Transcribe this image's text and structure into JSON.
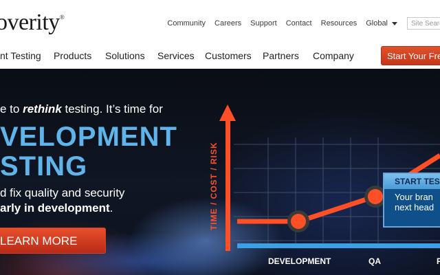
{
  "header": {
    "logo_text": "overity",
    "logo_mark": "®",
    "utility_links": [
      "Community",
      "Careers",
      "Support",
      "Contact",
      "Resources"
    ],
    "global_label": "Global",
    "search_placeholder": "Site Search"
  },
  "nav": {
    "items": [
      "nt Testing",
      "Products",
      "Solutions",
      "Services",
      "Customers",
      "Partners",
      "Company"
    ],
    "cta": "Start Your Free"
  },
  "hero": {
    "line1_pre": "e to ",
    "line1_em": "rethink",
    "line1_post": " testing. It’s time for",
    "big1": "VELOPMENT",
    "big2": "STING",
    "line2": "d fix quality and security",
    "line3": "arly in development",
    "line3_post": ".",
    "learn_more": "LEARN MORE",
    "y_axis_label": "TIME / COST / RISK",
    "x_labels": [
      "DEVELOPMENT",
      "QA",
      "P"
    ],
    "callout_title": "START TES",
    "callout_body": [
      "Your bran",
      "next head"
    ]
  },
  "colors": {
    "accent_orange": "#e0522a",
    "headline_blue": "#5fb4ea",
    "axis_blue": "#3aa0e8"
  }
}
